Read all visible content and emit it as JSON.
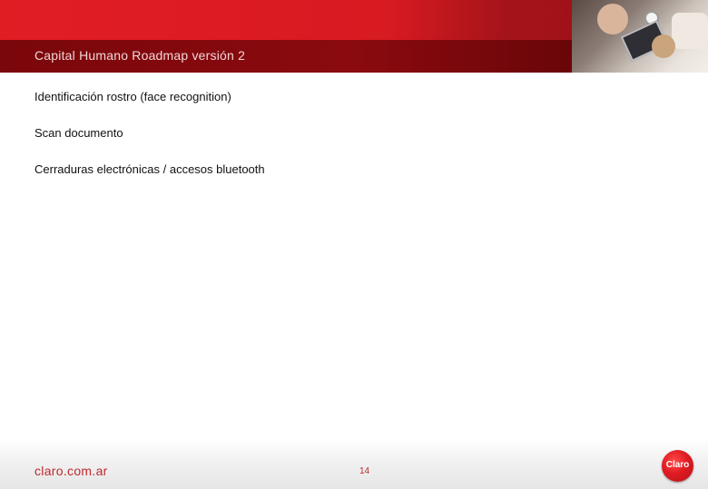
{
  "header": {
    "title": "Capital Humano Roadmap versión 2"
  },
  "main": {
    "items": [
      "Identificación rostro (face recognition)",
      "Scan documento",
      "Cerraduras electrónicas / accesos bluetooth"
    ]
  },
  "footer": {
    "url": "claro.com.ar",
    "page_number": "14",
    "logo_text": "Claro"
  },
  "colors": {
    "brand_red": "#d71920",
    "dark_red": "#7a070b",
    "footer_text": "#c1272d"
  },
  "icons": {
    "logo": "claro-logo-icon",
    "header_photo": "meeting-photo-icon"
  }
}
